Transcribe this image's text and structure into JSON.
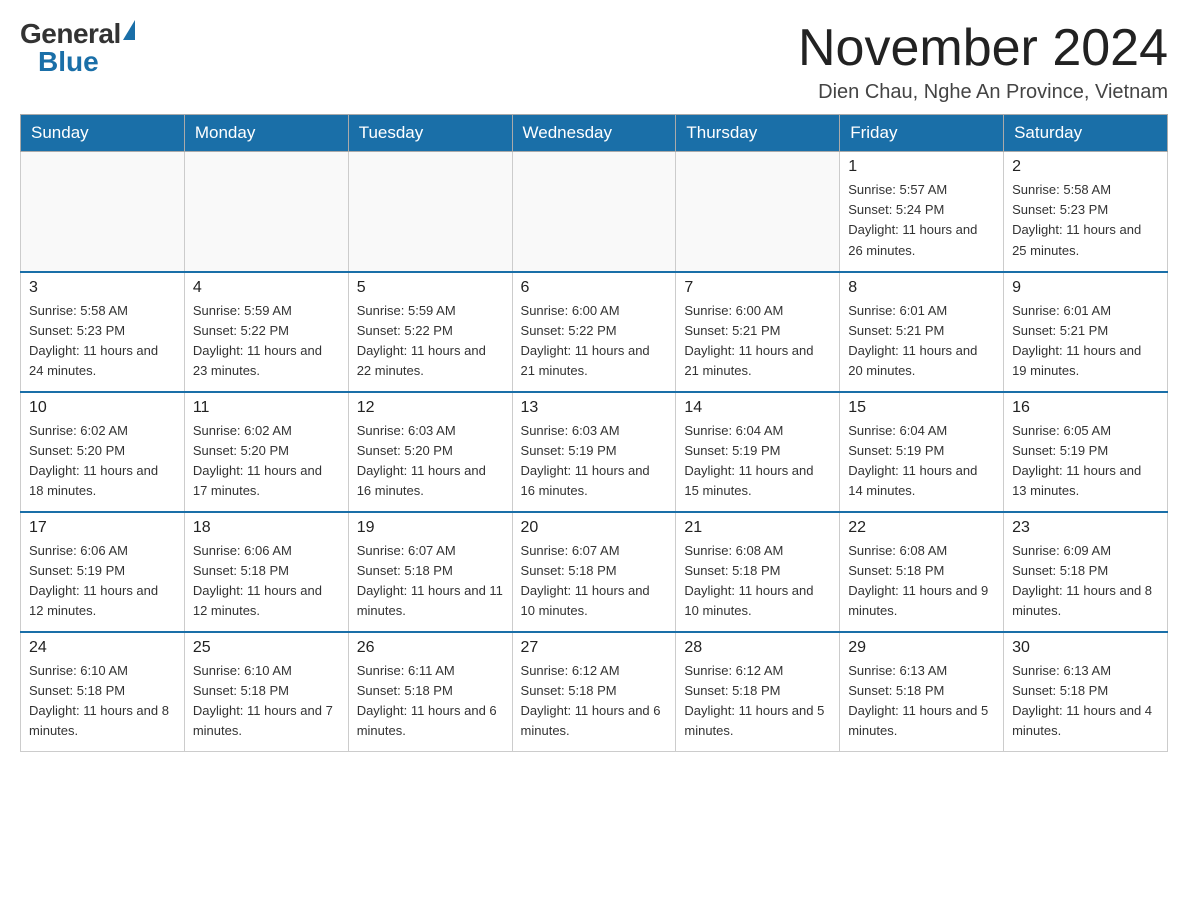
{
  "header": {
    "logo_general": "General",
    "logo_blue": "Blue",
    "title": "November 2024",
    "location": "Dien Chau, Nghe An Province, Vietnam"
  },
  "weekdays": [
    "Sunday",
    "Monday",
    "Tuesday",
    "Wednesday",
    "Thursday",
    "Friday",
    "Saturday"
  ],
  "weeks": [
    [
      {
        "day": "",
        "info": ""
      },
      {
        "day": "",
        "info": ""
      },
      {
        "day": "",
        "info": ""
      },
      {
        "day": "",
        "info": ""
      },
      {
        "day": "",
        "info": ""
      },
      {
        "day": "1",
        "info": "Sunrise: 5:57 AM\nSunset: 5:24 PM\nDaylight: 11 hours and 26 minutes."
      },
      {
        "day": "2",
        "info": "Sunrise: 5:58 AM\nSunset: 5:23 PM\nDaylight: 11 hours and 25 minutes."
      }
    ],
    [
      {
        "day": "3",
        "info": "Sunrise: 5:58 AM\nSunset: 5:23 PM\nDaylight: 11 hours and 24 minutes."
      },
      {
        "day": "4",
        "info": "Sunrise: 5:59 AM\nSunset: 5:22 PM\nDaylight: 11 hours and 23 minutes."
      },
      {
        "day": "5",
        "info": "Sunrise: 5:59 AM\nSunset: 5:22 PM\nDaylight: 11 hours and 22 minutes."
      },
      {
        "day": "6",
        "info": "Sunrise: 6:00 AM\nSunset: 5:22 PM\nDaylight: 11 hours and 21 minutes."
      },
      {
        "day": "7",
        "info": "Sunrise: 6:00 AM\nSunset: 5:21 PM\nDaylight: 11 hours and 21 minutes."
      },
      {
        "day": "8",
        "info": "Sunrise: 6:01 AM\nSunset: 5:21 PM\nDaylight: 11 hours and 20 minutes."
      },
      {
        "day": "9",
        "info": "Sunrise: 6:01 AM\nSunset: 5:21 PM\nDaylight: 11 hours and 19 minutes."
      }
    ],
    [
      {
        "day": "10",
        "info": "Sunrise: 6:02 AM\nSunset: 5:20 PM\nDaylight: 11 hours and 18 minutes."
      },
      {
        "day": "11",
        "info": "Sunrise: 6:02 AM\nSunset: 5:20 PM\nDaylight: 11 hours and 17 minutes."
      },
      {
        "day": "12",
        "info": "Sunrise: 6:03 AM\nSunset: 5:20 PM\nDaylight: 11 hours and 16 minutes."
      },
      {
        "day": "13",
        "info": "Sunrise: 6:03 AM\nSunset: 5:19 PM\nDaylight: 11 hours and 16 minutes."
      },
      {
        "day": "14",
        "info": "Sunrise: 6:04 AM\nSunset: 5:19 PM\nDaylight: 11 hours and 15 minutes."
      },
      {
        "day": "15",
        "info": "Sunrise: 6:04 AM\nSunset: 5:19 PM\nDaylight: 11 hours and 14 minutes."
      },
      {
        "day": "16",
        "info": "Sunrise: 6:05 AM\nSunset: 5:19 PM\nDaylight: 11 hours and 13 minutes."
      }
    ],
    [
      {
        "day": "17",
        "info": "Sunrise: 6:06 AM\nSunset: 5:19 PM\nDaylight: 11 hours and 12 minutes."
      },
      {
        "day": "18",
        "info": "Sunrise: 6:06 AM\nSunset: 5:18 PM\nDaylight: 11 hours and 12 minutes."
      },
      {
        "day": "19",
        "info": "Sunrise: 6:07 AM\nSunset: 5:18 PM\nDaylight: 11 hours and 11 minutes."
      },
      {
        "day": "20",
        "info": "Sunrise: 6:07 AM\nSunset: 5:18 PM\nDaylight: 11 hours and 10 minutes."
      },
      {
        "day": "21",
        "info": "Sunrise: 6:08 AM\nSunset: 5:18 PM\nDaylight: 11 hours and 10 minutes."
      },
      {
        "day": "22",
        "info": "Sunrise: 6:08 AM\nSunset: 5:18 PM\nDaylight: 11 hours and 9 minutes."
      },
      {
        "day": "23",
        "info": "Sunrise: 6:09 AM\nSunset: 5:18 PM\nDaylight: 11 hours and 8 minutes."
      }
    ],
    [
      {
        "day": "24",
        "info": "Sunrise: 6:10 AM\nSunset: 5:18 PM\nDaylight: 11 hours and 8 minutes."
      },
      {
        "day": "25",
        "info": "Sunrise: 6:10 AM\nSunset: 5:18 PM\nDaylight: 11 hours and 7 minutes."
      },
      {
        "day": "26",
        "info": "Sunrise: 6:11 AM\nSunset: 5:18 PM\nDaylight: 11 hours and 6 minutes."
      },
      {
        "day": "27",
        "info": "Sunrise: 6:12 AM\nSunset: 5:18 PM\nDaylight: 11 hours and 6 minutes."
      },
      {
        "day": "28",
        "info": "Sunrise: 6:12 AM\nSunset: 5:18 PM\nDaylight: 11 hours and 5 minutes."
      },
      {
        "day": "29",
        "info": "Sunrise: 6:13 AM\nSunset: 5:18 PM\nDaylight: 11 hours and 5 minutes."
      },
      {
        "day": "30",
        "info": "Sunrise: 6:13 AM\nSunset: 5:18 PM\nDaylight: 11 hours and 4 minutes."
      }
    ]
  ]
}
